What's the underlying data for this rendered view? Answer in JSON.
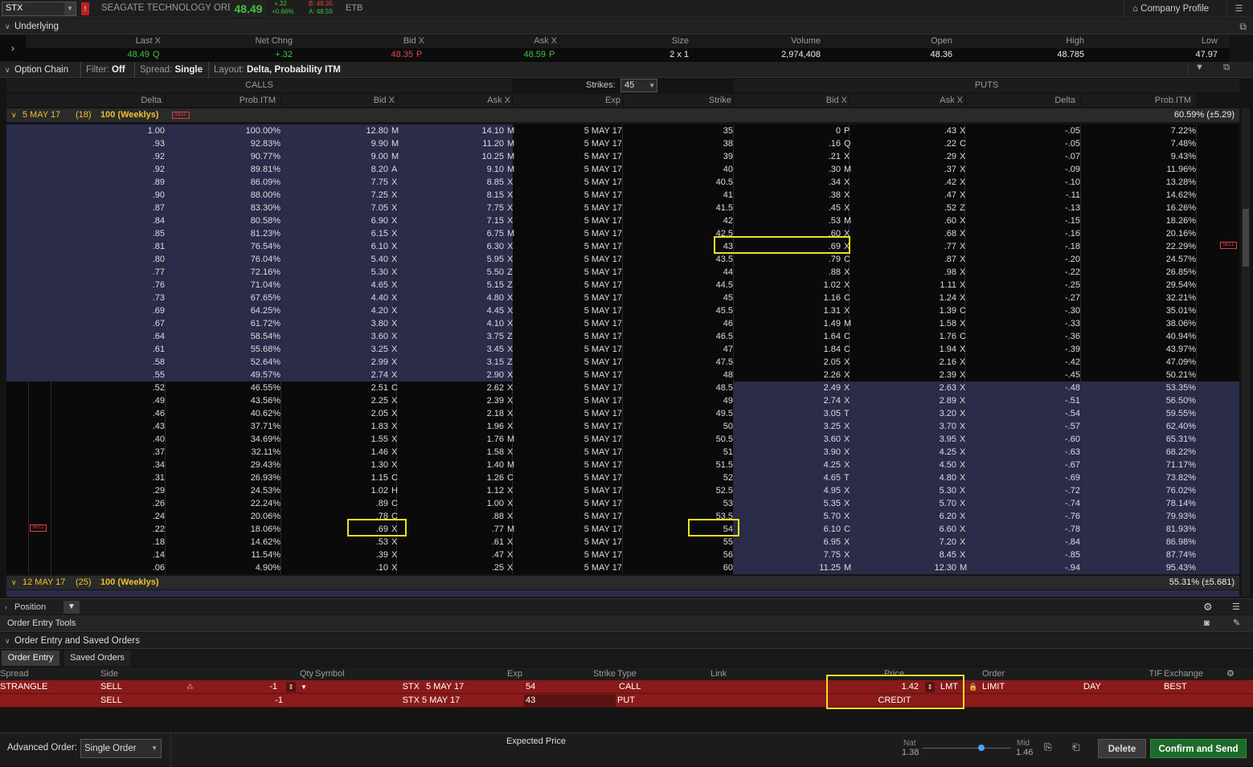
{
  "top": {
    "symbol": "STX",
    "name": "SEAGATE TECHNOLOGY ORD",
    "last": "48.49",
    "change": "+.32",
    "change_pct": "+0.66%",
    "bid": "B: 48.35",
    "ask": "A: 48.59",
    "etb": "ETB",
    "company_profile": "Company Profile"
  },
  "underlying": {
    "title": "Underlying",
    "headers": [
      "Last X",
      "Net Chng",
      "Bid X",
      "Ask X",
      "Size",
      "Volume",
      "Open",
      "High",
      "Low"
    ],
    "values": {
      "last": "48.49",
      "last_ex": "Q",
      "net": "+.32",
      "bid": "48.35",
      "bid_ex": "P",
      "ask": "48.59",
      "ask_ex": "P",
      "size": "2 x 1",
      "volume": "2,974,408",
      "open": "48.36",
      "high": "48.785",
      "low": "47.97"
    }
  },
  "chain_bar": {
    "title": "Option Chain",
    "filter_label": "Filter:",
    "filter_value": "Off",
    "spread_label": "Spread:",
    "spread_value": "Single",
    "layout_label": "Layout:",
    "layout_value": "Delta, Probability ITM"
  },
  "chain_header": {
    "calls": "CALLS",
    "puts": "PUTS",
    "strikes_label": "Strikes:",
    "strikes_value": "45",
    "cols": {
      "delta": "Delta",
      "prob": "Prob.ITM",
      "bid": "Bid X",
      "ask": "Ask X",
      "exp": "Exp",
      "strike": "Strike",
      "pbid": "Bid X",
      "pask": "Ask X",
      "pdelta": "Delta",
      "pprob": "Prob.ITM"
    }
  },
  "expiry1": {
    "label": "5 MAY 17",
    "count": "(18)",
    "mult": "100 (Weeklys)",
    "sell": "SELL",
    "iv": "60.59% (±5.29)"
  },
  "expiry2": {
    "label": "12 MAY 17",
    "count": "(25)",
    "mult": "100 (Weeklys)",
    "iv": "55.31% (±5.681)"
  },
  "rows": [
    [
      "1.00",
      "100.00%",
      "12.80",
      "M",
      "14.10",
      "M",
      "5 MAY 17",
      "35",
      "0",
      "P",
      ".43",
      "X",
      "-.05",
      "7.22%"
    ],
    [
      ".93",
      "92.83%",
      "9.90",
      "M",
      "11.20",
      "M",
      "5 MAY 17",
      "38",
      ".16",
      "Q",
      ".22",
      "C",
      "-.05",
      "7.48%"
    ],
    [
      ".92",
      "90.77%",
      "9.00",
      "M",
      "10.25",
      "M",
      "5 MAY 17",
      "39",
      ".21",
      "X",
      ".29",
      "X",
      "-.07",
      "9.43%"
    ],
    [
      ".92",
      "89.81%",
      "8.20",
      "A",
      "9.10",
      "M",
      "5 MAY 17",
      "40",
      ".30",
      "M",
      ".37",
      "X",
      "-.09",
      "11.96%"
    ],
    [
      ".89",
      "86.09%",
      "7.75",
      "X",
      "8.85",
      "X",
      "5 MAY 17",
      "40.5",
      ".34",
      "X",
      ".42",
      "X",
      "-.10",
      "13.28%"
    ],
    [
      ".90",
      "88.00%",
      "7.25",
      "X",
      "8.15",
      "X",
      "5 MAY 17",
      "41",
      ".38",
      "X",
      ".47",
      "X",
      "-.11",
      "14.62%"
    ],
    [
      ".87",
      "83.30%",
      "7.05",
      "X",
      "7.75",
      "X",
      "5 MAY 17",
      "41.5",
      ".45",
      "X",
      ".52",
      "Z",
      "-.13",
      "16.26%"
    ],
    [
      ".84",
      "80.58%",
      "6.90",
      "X",
      "7.15",
      "X",
      "5 MAY 17",
      "42",
      ".53",
      "M",
      ".60",
      "X",
      "-.15",
      "18.26%"
    ],
    [
      ".85",
      "81.23%",
      "6.15",
      "X",
      "6.75",
      "M",
      "5 MAY 17",
      "42.5",
      ".60",
      "X",
      ".68",
      "X",
      "-.16",
      "20.16%"
    ],
    [
      ".81",
      "76.54%",
      "6.10",
      "X",
      "6.30",
      "X",
      "5 MAY 17",
      "43",
      ".69",
      "X",
      ".77",
      "X",
      "-.18",
      "22.29%"
    ],
    [
      ".80",
      "76.04%",
      "5.40",
      "X",
      "5.95",
      "X",
      "5 MAY 17",
      "43.5",
      ".79",
      "C",
      ".87",
      "X",
      "-.20",
      "24.57%"
    ],
    [
      ".77",
      "72.16%",
      "5.30",
      "X",
      "5.50",
      "Z",
      "5 MAY 17",
      "44",
      ".88",
      "X",
      ".98",
      "X",
      "-.22",
      "26.85%"
    ],
    [
      ".76",
      "71.04%",
      "4.65",
      "X",
      "5.15",
      "Z",
      "5 MAY 17",
      "44.5",
      "1.02",
      "X",
      "1.11",
      "X",
      "-.25",
      "29.54%"
    ],
    [
      ".73",
      "67.65%",
      "4.40",
      "X",
      "4.80",
      "X",
      "5 MAY 17",
      "45",
      "1.16",
      "C",
      "1.24",
      "X",
      "-.27",
      "32.21%"
    ],
    [
      ".69",
      "64.25%",
      "4.20",
      "X",
      "4.45",
      "X",
      "5 MAY 17",
      "45.5",
      "1.31",
      "X",
      "1.39",
      "C",
      "-.30",
      "35.01%"
    ],
    [
      ".67",
      "61.72%",
      "3.80",
      "X",
      "4.10",
      "X",
      "5 MAY 17",
      "46",
      "1.49",
      "M",
      "1.58",
      "X",
      "-.33",
      "38.06%"
    ],
    [
      ".64",
      "58.54%",
      "3.60",
      "X",
      "3.75",
      "Z",
      "5 MAY 17",
      "46.5",
      "1.64",
      "C",
      "1.76",
      "C",
      "-.36",
      "40.94%"
    ],
    [
      ".61",
      "55.68%",
      "3.25",
      "X",
      "3.45",
      "X",
      "5 MAY 17",
      "47",
      "1.84",
      "C",
      "1.94",
      "X",
      "-.39",
      "43.97%"
    ],
    [
      ".58",
      "52.64%",
      "2.99",
      "X",
      "3.15",
      "Z",
      "5 MAY 17",
      "47.5",
      "2.05",
      "X",
      "2.16",
      "X",
      "-.42",
      "47.09%"
    ],
    [
      ".55",
      "49.57%",
      "2.74",
      "X",
      "2.90",
      "X",
      "5 MAY 17",
      "48",
      "2.26",
      "X",
      "2.39",
      "X",
      "-.45",
      "50.21%"
    ],
    [
      ".52",
      "46.55%",
      "2.51",
      "C",
      "2.62",
      "X",
      "5 MAY 17",
      "48.5",
      "2.49",
      "X",
      "2.63",
      "X",
      "-.48",
      "53.35%"
    ],
    [
      ".49",
      "43.56%",
      "2.25",
      "X",
      "2.39",
      "X",
      "5 MAY 17",
      "49",
      "2.74",
      "X",
      "2.89",
      "X",
      "-.51",
      "56.50%"
    ],
    [
      ".46",
      "40.62%",
      "2.05",
      "X",
      "2.18",
      "X",
      "5 MAY 17",
      "49.5",
      "3.05",
      "T",
      "3.20",
      "X",
      "-.54",
      "59.55%"
    ],
    [
      ".43",
      "37.71%",
      "1.83",
      "X",
      "1.96",
      "X",
      "5 MAY 17",
      "50",
      "3.25",
      "X",
      "3.70",
      "X",
      "-.57",
      "62.40%"
    ],
    [
      ".40",
      "34.69%",
      "1.55",
      "X",
      "1.76",
      "M",
      "5 MAY 17",
      "50.5",
      "3.60",
      "X",
      "3.95",
      "X",
      "-.60",
      "65.31%"
    ],
    [
      ".37",
      "32.11%",
      "1.46",
      "X",
      "1.58",
      "X",
      "5 MAY 17",
      "51",
      "3.90",
      "X",
      "4.25",
      "X",
      "-.63",
      "68.22%"
    ],
    [
      ".34",
      "29.43%",
      "1.30",
      "X",
      "1.40",
      "M",
      "5 MAY 17",
      "51.5",
      "4.25",
      "X",
      "4.50",
      "X",
      "-.67",
      "71.17%"
    ],
    [
      ".31",
      "26.93%",
      "1.15",
      "C",
      "1.26",
      "C",
      "5 MAY 17",
      "52",
      "4.65",
      "T",
      "4.80",
      "X",
      "-.69",
      "73.82%"
    ],
    [
      ".29",
      "24.53%",
      "1.02",
      "H",
      "1.12",
      "X",
      "5 MAY 17",
      "52.5",
      "4.95",
      "X",
      "5.30",
      "X",
      "-.72",
      "76.02%"
    ],
    [
      ".26",
      "22.24%",
      ".89",
      "C",
      "1.00",
      "X",
      "5 MAY 17",
      "53",
      "5.35",
      "X",
      "5.70",
      "X",
      "-.74",
      "78.14%"
    ],
    [
      ".24",
      "20.06%",
      ".78",
      "C",
      ".88",
      "X",
      "5 MAY 17",
      "53.5",
      "5.70",
      "X",
      "6.20",
      "X",
      "-.76",
      "79.93%"
    ],
    [
      ".22",
      "18.06%",
      ".69",
      "X",
      ".77",
      "M",
      "5 MAY 17",
      "54",
      "6.10",
      "C",
      "6.60",
      "X",
      "-.78",
      "81.93%"
    ],
    [
      ".18",
      "14.62%",
      ".53",
      "X",
      ".61",
      "X",
      "5 MAY 17",
      "55",
      "6.95",
      "X",
      "7.20",
      "X",
      "-.84",
      "86.98%"
    ],
    [
      ".14",
      "11.54%",
      ".39",
      "X",
      ".47",
      "X",
      "5 MAY 17",
      "56",
      "7.75",
      "X",
      "8.45",
      "X",
      "-.85",
      "87.74%"
    ],
    [
      ".06",
      "4.90%",
      ".10",
      "X",
      ".25",
      "X",
      "5 MAY 17",
      "60",
      "11.25",
      "M",
      "12.30",
      "M",
      "-.94",
      "95.43%"
    ]
  ],
  "row_sell": "SELL",
  "position": {
    "label": "Position"
  },
  "order_tools": {
    "title": "Order Entry Tools",
    "sub": "Order Entry and Saved Orders",
    "tab1": "Order Entry",
    "tab2": "Saved Orders"
  },
  "order_cols": [
    "Spread",
    "Side",
    "Qty",
    "Symbol",
    "Exp",
    "Strike",
    "Type",
    "Link",
    "Price",
    "Order",
    "TIF",
    "Exchange"
  ],
  "order1": {
    "spread": "STRANGLE",
    "side": "SELL",
    "qty": "-1",
    "symbol": "STX",
    "exp": "5 MAY 17",
    "strike": "54",
    "type": "CALL",
    "price": "1.42",
    "lmt": "LMT",
    "order": "LIMIT",
    "tif": "DAY",
    "exchange": "BEST"
  },
  "order2": {
    "side": "SELL",
    "qty": "-1",
    "symbol": "STX",
    "exp": "5 MAY 17",
    "strike": "43",
    "type": "PUT",
    "credit": "CREDIT"
  },
  "bottom": {
    "adv_label": "Advanced Order:",
    "adv_value": "Single Order",
    "expected": "Expected  Price",
    "nat": "Nat",
    "nat_val": "1.38",
    "mid": "Mid",
    "mid_val": "1.46",
    "slider_pct": 0.66,
    "delete": "Delete",
    "confirm": "Confirm and Send"
  }
}
